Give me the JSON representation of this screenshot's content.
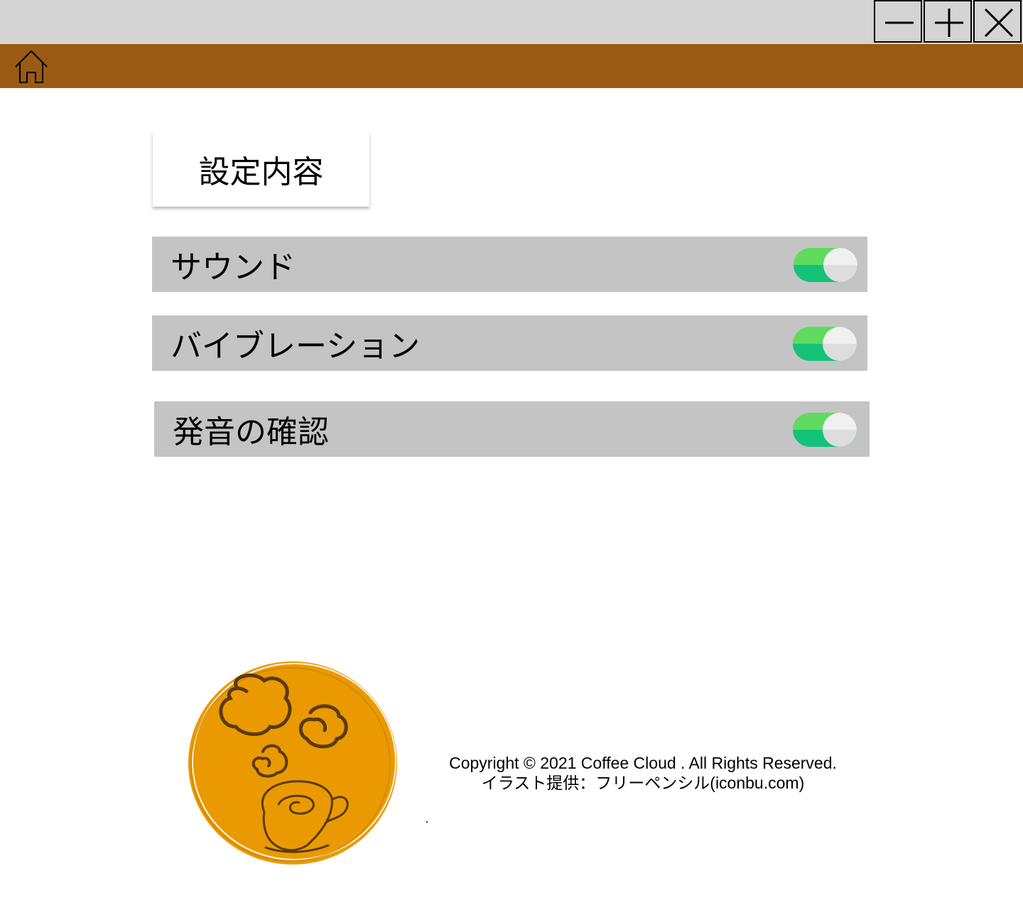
{
  "window_controls": {
    "minimize_icon": "minus-icon",
    "maximize_icon": "plus-icon",
    "close_icon": "x-icon"
  },
  "header": {
    "home_icon": "home-icon",
    "background_color": "#995b14"
  },
  "settings": {
    "title": "設定内容",
    "items": [
      {
        "label": "サウンド",
        "enabled": true
      },
      {
        "label": "バイブレーション",
        "enabled": true
      },
      {
        "label": "発音の確認",
        "enabled": true
      }
    ],
    "toggle_on_colors": [
      "#5fdb5f",
      "#14c27a"
    ]
  },
  "footer": {
    "logo_icon": "coffee-cup-logo",
    "logo_color": "#ea9a00",
    "copyright": "Copyright © 2021 Coffee Cloud . All Rights Reserved.",
    "illustration_credit": "イラスト提供：フリーペンシル(iconbu.com)"
  }
}
